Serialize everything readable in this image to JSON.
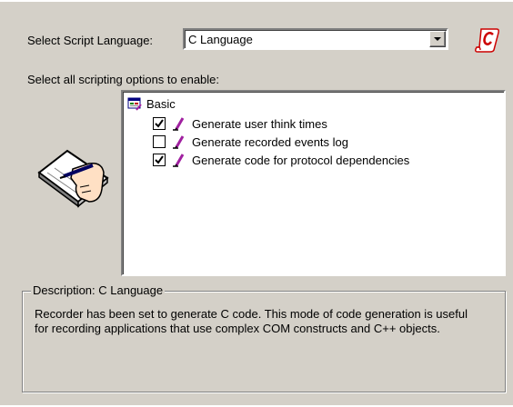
{
  "language": {
    "label": "Select Script Language:",
    "selected": "C Language"
  },
  "options": {
    "label": "Select all scripting options to enable:",
    "root": "Basic",
    "items": [
      {
        "label": "Generate user think times",
        "checked": true
      },
      {
        "label": "Generate recorded events log",
        "checked": false
      },
      {
        "label": "Generate code for protocol dependencies",
        "checked": true
      }
    ]
  },
  "description": {
    "title": "Description: C Language",
    "text": "Recorder has been set to generate C code.  This mode of code generation is useful for recording applications that use complex COM constructs and C++ objects."
  },
  "icons": {
    "script": "script-scroll-icon",
    "hand": "hand-writing-icon",
    "root": "options-tree-icon",
    "pen": "pen-icon",
    "dropdown": "chevron-down-icon"
  },
  "colors": {
    "background": "#d4d0c8",
    "pen": "#a020a0",
    "script_red": "#cc0000"
  }
}
